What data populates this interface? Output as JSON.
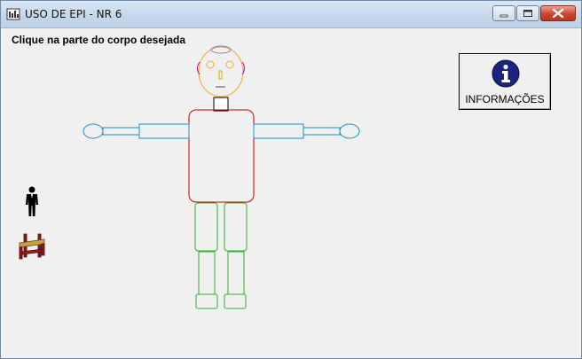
{
  "window": {
    "title": "USO DE EPI - NR 6"
  },
  "main": {
    "instruction": "Clique na parte do corpo desejada",
    "info_button_label": "INFORMAÇÕES"
  },
  "icons": {
    "app": "app-icon",
    "info": "info-icon",
    "person": "person-icon",
    "table": "table-icon"
  },
  "colors": {
    "head": "#f5a623",
    "torso": "#cc0000",
    "arms": "#1a8fc8",
    "legs": "#2db52d",
    "neck": "#000000",
    "info_circle": "#1a237e"
  }
}
